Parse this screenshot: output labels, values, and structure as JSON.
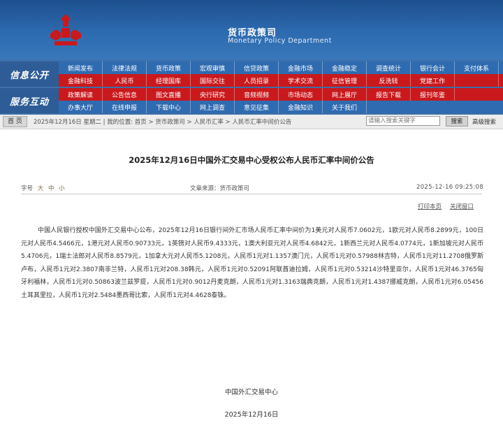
{
  "header": {
    "title_cn": "货币政策司",
    "title_en": "Monetary Policy Department",
    "brand_color": "#c9191d"
  },
  "nav": {
    "row1_label": "信息公开",
    "row2_label": "服务互动",
    "row1a": [
      "新闻发布",
      "法律法规",
      "货币政策",
      "宏观审慎",
      "信贷政策",
      "金融市场",
      "金融稳定",
      "调查统计",
      "银行会计",
      "支付体系"
    ],
    "row1b": [
      "金融科技",
      "人民币",
      "经理国库",
      "国际交往",
      "人员招录",
      "学术交流",
      "征信管理",
      "反洗钱",
      "党建工作",
      ""
    ],
    "row2a": [
      "政策解读",
      "公告信息",
      "图文直播",
      "央行研究",
      "音频视频",
      "市场动态",
      "网上展厅",
      "报告下载",
      "报刊年鉴"
    ],
    "row2b": [
      "办事大厅",
      "在线申报",
      "下载中心",
      "网上调查",
      "意见征集",
      "金融知识",
      "关于我们"
    ]
  },
  "breadcrumb": {
    "home": "首 页",
    "path": "2025年12月16日 星期二 | 我的位置: 首页 > 货币政策司 > 人民币汇率 > 人民币汇率中间价公告",
    "search_placeholder": "请输入搜索关键字",
    "search_button": "搜索",
    "advanced": "高级搜索"
  },
  "article": {
    "title": "2025年12月16日中国外汇交易中心受权公布人民币汇率中间价公告",
    "font_size_label": "字号",
    "font_sizes": [
      "大",
      "中",
      "小"
    ],
    "source": "文章来源：货币政策司",
    "date": "2025-12-16  09:25:08",
    "print": "打印本页",
    "close": "关闭窗口",
    "body": "中国人民银行授权中国外汇交易中心公布，2025年12月16日银行间外汇市场人民币汇率中间价为1美元对人民币7.0602元，1欧元对人民币8.2899元，100日元对人民币4.5466元，1港元对人民币0.90733元，1英镑对人民币9.4333元，1澳大利亚元对人民币4.6842元，1新西兰元对人民币4.0774元，1新加坡元对人民币5.4706元，1瑞士法郎对人民币8.8579元，1加拿大元对人民币5.1208元，人民币1元对1.1357澳门元，人民币1元对0.57988林吉特，人民币1元对11.2708俄罗斯卢布，人民币1元对2.3807南非兰特，人民币1元对208.38韩元，人民币1元对0.52091阿联酋迪拉姆，人民币1元对0.53214沙特里亚尔，人民币1元对46.3765匈牙利福林，人民币1元对0.50863波兰兹罗提，人民币1元对0.9012丹麦克朗，人民币1元对1.3163瑞典克朗，人民币1元对1.4387挪威克朗，人民币1元对6.05456土耳其里拉，人民币1元对2.5484墨西哥比索，人民币1元对4.4628泰铢。",
    "sign_org": "中国外汇交易中心",
    "sign_date": "2025年12月16日"
  }
}
